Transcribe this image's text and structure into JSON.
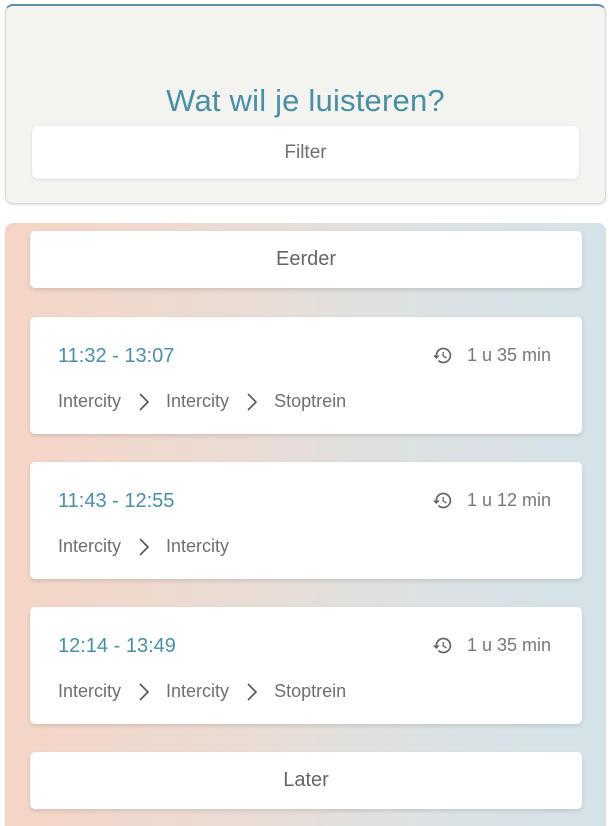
{
  "header": {
    "title": "Wat wil je luisteren?",
    "filter_placeholder": "Filter"
  },
  "navigation": {
    "earlier_label": "Eerder",
    "later_label": "Later"
  },
  "trips": [
    {
      "time": "11:32 - 13:07",
      "duration": "1 u 35 min",
      "route": [
        "Intercity",
        "Intercity",
        "Stoptrein"
      ]
    },
    {
      "time": "11:43 - 12:55",
      "duration": "1 u 12 min",
      "route": [
        "Intercity",
        "Intercity"
      ]
    },
    {
      "time": "12:14 - 13:49",
      "duration": "1 u 35 min",
      "route": [
        "Intercity",
        "Intercity",
        "Stoptrein"
      ]
    }
  ],
  "icons": {
    "duration": "history-icon",
    "route_separator": "chevron-right-icon"
  },
  "colors": {
    "accent": "#4a8fa3",
    "panel_background": "#f3f3ef",
    "gradient_left": "#f5d5c6",
    "gradient_right": "#d4e3e8"
  }
}
